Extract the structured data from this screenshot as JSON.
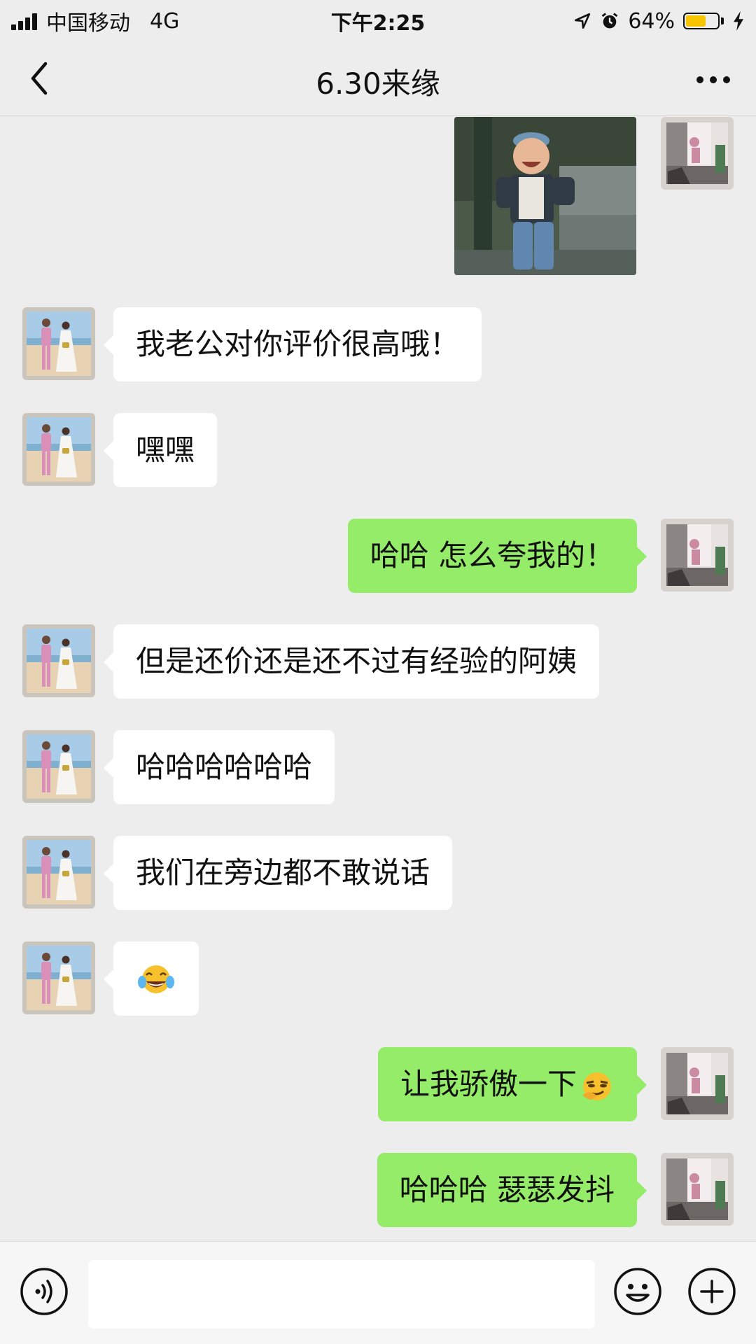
{
  "status_bar": {
    "carrier": "中国移动",
    "network": "4G",
    "time": "下午2:25",
    "battery_percent": "64%",
    "battery_level": 0.64,
    "icons": [
      "signal-bars-icon",
      "location-arrow-icon",
      "alarm-clock-icon",
      "battery-icon",
      "charging-bolt-icon"
    ]
  },
  "nav": {
    "title": "6.30来缘",
    "back_icon": "chevron-left-icon",
    "more_icon": "more-dots-icon"
  },
  "messages": [
    {
      "side": "right",
      "type": "image",
      "content": "photo of a smiling child"
    },
    {
      "side": "left",
      "type": "text",
      "text": "我老公对你评价很高哦！"
    },
    {
      "side": "left",
      "type": "text",
      "text": "嘿嘿"
    },
    {
      "side": "right",
      "type": "text",
      "text": "哈哈 怎么夸我的！"
    },
    {
      "side": "left",
      "type": "text",
      "text": "但是还价还是还不过有经验的阿姨"
    },
    {
      "side": "left",
      "type": "text",
      "text": "哈哈哈哈哈哈"
    },
    {
      "side": "left",
      "type": "text",
      "text": "我们在旁边都不敢说话"
    },
    {
      "side": "left",
      "type": "emoji",
      "emoji": "tears-of-joy-emoji"
    },
    {
      "side": "right",
      "type": "text",
      "text": "让我骄傲一下",
      "emoji": "smirk-emoji"
    },
    {
      "side": "right",
      "type": "text",
      "text": "哈哈哈 瑟瑟发抖"
    }
  ],
  "input_bar": {
    "value": "",
    "voice_icon": "voice-icon",
    "emoji_icon": "emoji-icon",
    "plus_icon": "plus-icon"
  },
  "colors": {
    "background": "#ededed",
    "sent_bubble": "#95ec69",
    "received_bubble": "#ffffff",
    "battery_fill": "#f7c500"
  }
}
